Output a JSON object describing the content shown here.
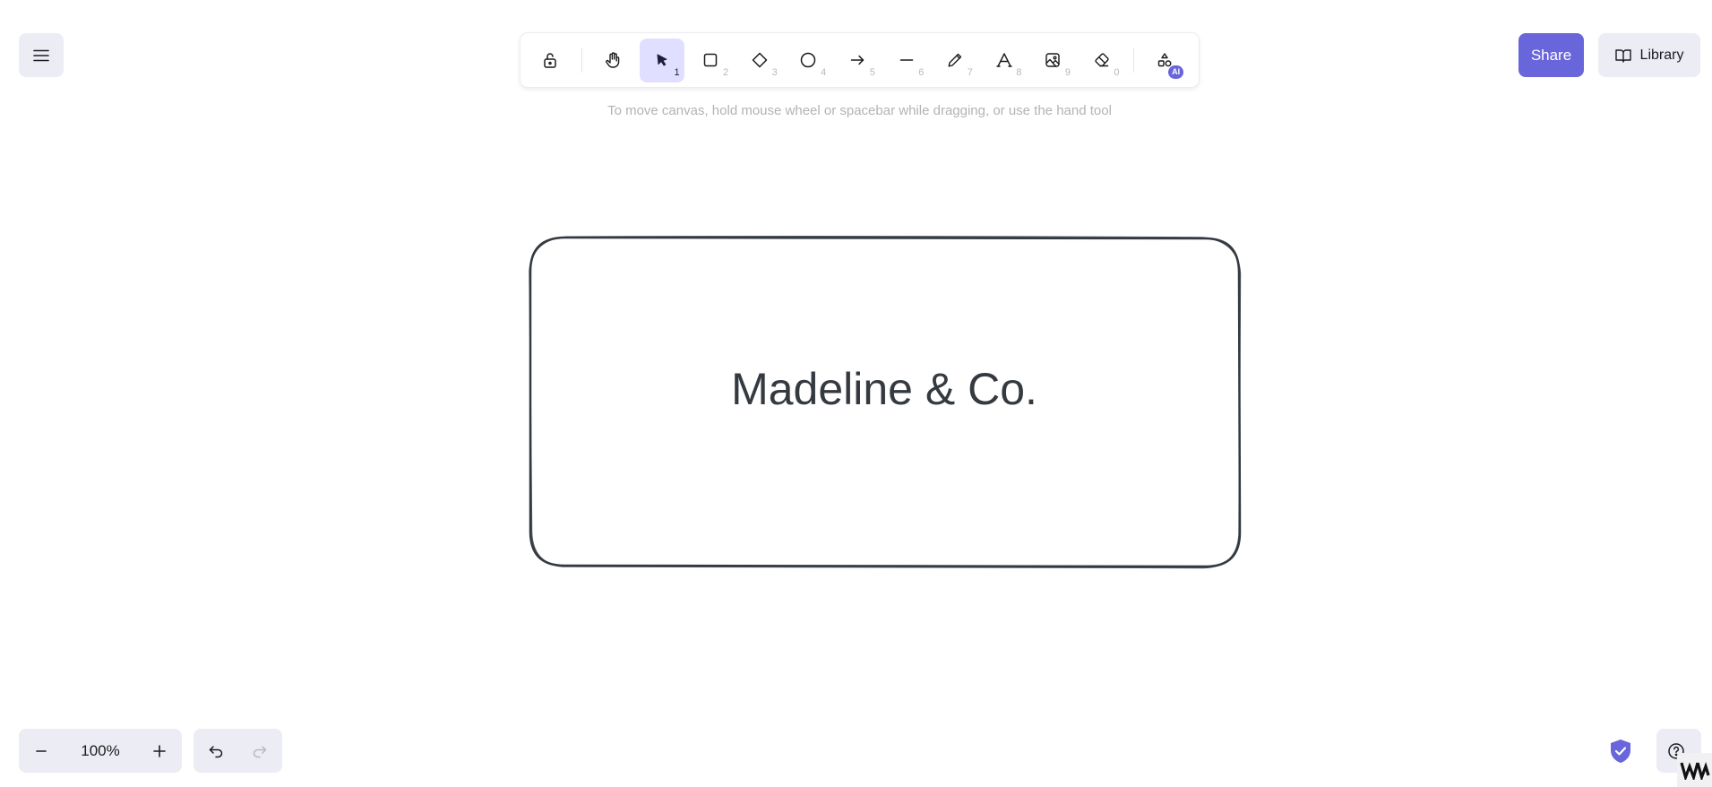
{
  "toolbar": {
    "tools": [
      {
        "name": "lock",
        "shortcut": ""
      },
      {
        "name": "hand",
        "shortcut": ""
      },
      {
        "name": "selection",
        "shortcut": "1",
        "active": true
      },
      {
        "name": "rectangle",
        "shortcut": "2"
      },
      {
        "name": "diamond",
        "shortcut": "3"
      },
      {
        "name": "ellipse",
        "shortcut": "4"
      },
      {
        "name": "arrow",
        "shortcut": "5"
      },
      {
        "name": "line",
        "shortcut": "6"
      },
      {
        "name": "draw",
        "shortcut": "7"
      },
      {
        "name": "text",
        "shortcut": "8"
      },
      {
        "name": "image",
        "shortcut": "9"
      },
      {
        "name": "eraser",
        "shortcut": "0"
      },
      {
        "name": "more-tools",
        "shortcut": ""
      }
    ],
    "ai_badge": "AI"
  },
  "hint": "To move canvas, hold mouse wheel or spacebar while dragging, or use the hand tool",
  "header": {
    "share_label": "Share",
    "library_label": "Library"
  },
  "canvas": {
    "text": "Madeline & Co."
  },
  "footer": {
    "zoom": "100%"
  },
  "colors": {
    "accent": "#6965db",
    "active_tool_bg": "#e0dfff",
    "button_bg": "#ececf4",
    "stroke": "#343a40"
  }
}
